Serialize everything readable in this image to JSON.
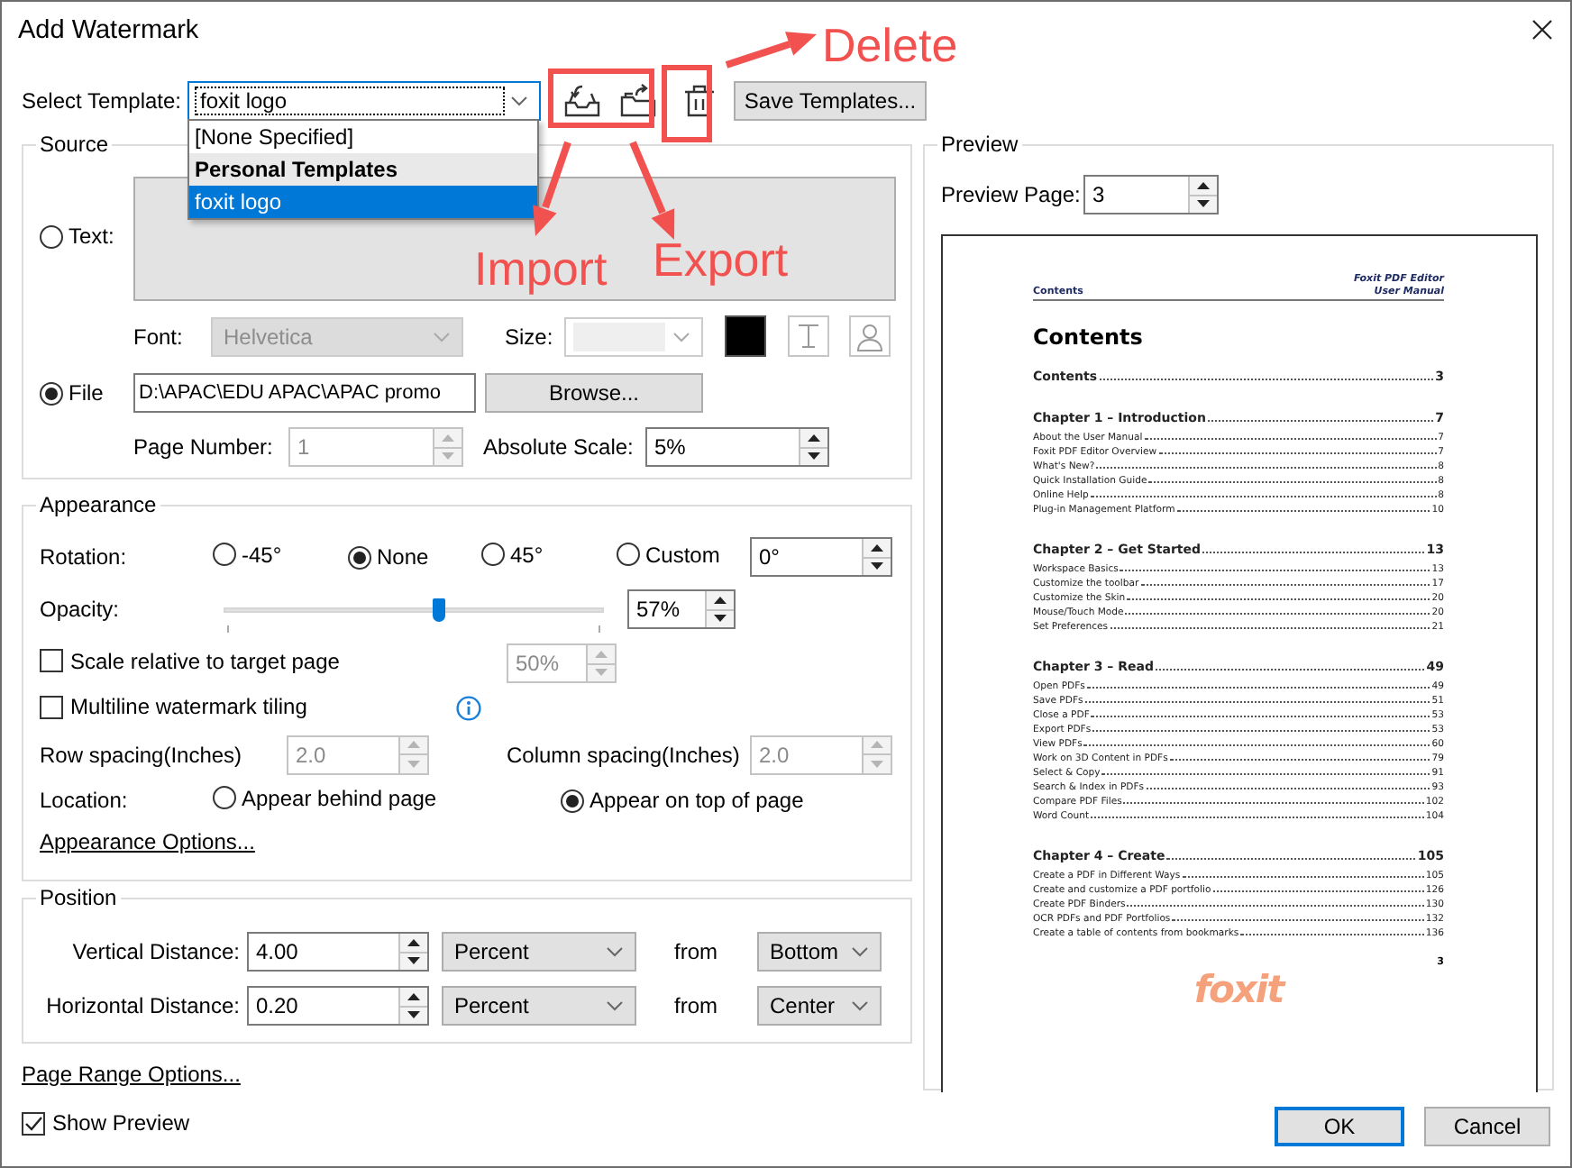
{
  "window": {
    "title": "Add Watermark"
  },
  "template": {
    "label": "Select Template:",
    "value": "foxit logo",
    "expanded": true,
    "dropdown": [
      {
        "text": "[None Specified]",
        "kind": "option",
        "selected": false
      },
      {
        "text": "Personal Templates",
        "kind": "header",
        "selected": false
      },
      {
        "text": "foxit logo",
        "kind": "option",
        "selected": true
      }
    ],
    "save_button": "Save Templates..."
  },
  "source": {
    "title": "Source",
    "text_option": {
      "label": "Text:",
      "selected": false
    },
    "text_field": {
      "disabled": true
    },
    "font": {
      "label": "Font:",
      "value": "Helvetica",
      "disabled": true
    },
    "size": {
      "label": "Size:",
      "disabled": true
    },
    "text_color": {
      "color": "#000000"
    },
    "file_option": {
      "label": "File",
      "selected": true
    },
    "file_path": "D:\\APAC\\EDU APAC\\APAC promo",
    "browse_button": "Browse...",
    "page_number": {
      "label": "Page Number:",
      "value": "1",
      "disabled": true
    },
    "absolute_scale": {
      "label": "Absolute Scale:",
      "value": "5%",
      "disabled": false
    }
  },
  "appearance": {
    "title": "Appearance",
    "rotation": {
      "label": "Rotation:",
      "options": [
        {
          "label": "-45°",
          "selected": false
        },
        {
          "label": "None",
          "selected": true
        },
        {
          "label": "45°",
          "selected": false
        },
        {
          "label": "Custom",
          "selected": false
        }
      ],
      "custom_value": "0°"
    },
    "opacity": {
      "label": "Opacity:",
      "level": 0.57,
      "value": "57%"
    },
    "scale_relative": {
      "label": "Scale relative to target page",
      "checked": false,
      "value": "50%"
    },
    "multiline": {
      "label": "Multiline watermark tiling",
      "checked": false
    },
    "row_spacing": {
      "label": "Row spacing(Inches)",
      "value": "2.0",
      "disabled": true
    },
    "column_spacing": {
      "label": "Column spacing(Inches)",
      "value": "2.0",
      "disabled": true
    },
    "location": {
      "label": "Location:",
      "options": [
        {
          "label": "Appear behind page",
          "selected": false
        },
        {
          "label": "Appear on top of page",
          "selected": true
        }
      ]
    },
    "options_link": "Appearance Options..."
  },
  "position": {
    "title": "Position",
    "rows": [
      {
        "label": "Vertical Distance:",
        "value": "4.00",
        "unit": "Percent",
        "from_label": "from",
        "anchor": "Bottom"
      },
      {
        "label": "Horizontal Distance:",
        "value": "0.20",
        "unit": "Percent",
        "from_label": "from",
        "anchor": "Center"
      }
    ]
  },
  "page_range_link": "Page Range Options...",
  "show_preview": {
    "label": "Show Preview",
    "checked": true
  },
  "preview": {
    "title": "Preview",
    "page_label": "Preview Page:",
    "page_value": "3",
    "document": {
      "header_left": "Contents",
      "header_right": [
        "Foxit PDF Editor",
        "User Manual"
      ],
      "heading": "Contents",
      "toc": [
        {
          "text": "Contents",
          "page": "3",
          "kind": "chapter"
        },
        {
          "text": "Chapter 1 – Introduction",
          "page": "7",
          "kind": "chapter"
        },
        {
          "text": "About the User Manual",
          "page": "7",
          "kind": "section"
        },
        {
          "text": "Foxit PDF Editor Overview",
          "page": "7",
          "kind": "section"
        },
        {
          "text": "What's New?",
          "page": "8",
          "kind": "section"
        },
        {
          "text": "Quick Installation Guide",
          "page": "8",
          "kind": "section"
        },
        {
          "text": "Online Help",
          "page": "8",
          "kind": "section"
        },
        {
          "text": "Plug-in Management Platform",
          "page": "10",
          "kind": "section"
        },
        {
          "text": "Chapter 2 – Get Started",
          "page": "13",
          "kind": "chapter"
        },
        {
          "text": "Workspace Basics",
          "page": "13",
          "kind": "section"
        },
        {
          "text": "Customize the toolbar",
          "page": "17",
          "kind": "section"
        },
        {
          "text": "Customize the Skin",
          "page": "20",
          "kind": "section"
        },
        {
          "text": "Mouse/Touch Mode",
          "page": "20",
          "kind": "section"
        },
        {
          "text": "Set Preferences",
          "page": "21",
          "kind": "section"
        },
        {
          "text": "Chapter 3 – Read",
          "page": "49",
          "kind": "chapter"
        },
        {
          "text": "Open PDFs",
          "page": "49",
          "kind": "section"
        },
        {
          "text": "Save PDFs",
          "page": "51",
          "kind": "section"
        },
        {
          "text": "Close a PDF",
          "page": "53",
          "kind": "section"
        },
        {
          "text": "Export PDFs",
          "page": "53",
          "kind": "section"
        },
        {
          "text": "View PDFs",
          "page": "60",
          "kind": "section"
        },
        {
          "text": "Work on 3D Content in PDFs",
          "page": "79",
          "kind": "section"
        },
        {
          "text": "Select & Copy",
          "page": "91",
          "kind": "section"
        },
        {
          "text": "Search & Index in PDFs",
          "page": "93",
          "kind": "section"
        },
        {
          "text": "Compare PDF Files",
          "page": "102",
          "kind": "section"
        },
        {
          "text": "Word Count",
          "page": "104",
          "kind": "section"
        },
        {
          "text": "Chapter 4 – Create",
          "page": "105",
          "kind": "chapter"
        },
        {
          "text": "Create a PDF in Different Ways",
          "page": "105",
          "kind": "section"
        },
        {
          "text": "Create and customize a PDF portfolio",
          "page": "126",
          "kind": "section"
        },
        {
          "text": "Create PDF Binders",
          "page": "130",
          "kind": "section"
        },
        {
          "text": "OCR PDFs and PDF Portfolios",
          "page": "132",
          "kind": "section"
        },
        {
          "text": "Create a table of contents from bookmarks",
          "page": "136",
          "kind": "section"
        }
      ],
      "page_number": "3",
      "watermark": "foxit"
    }
  },
  "buttons": [
    {
      "label": "OK",
      "default": true
    },
    {
      "label": "Cancel",
      "default": false
    }
  ],
  "annotations": [
    {
      "text": "Import"
    },
    {
      "text": "Export"
    },
    {
      "text": "Delete"
    }
  ]
}
